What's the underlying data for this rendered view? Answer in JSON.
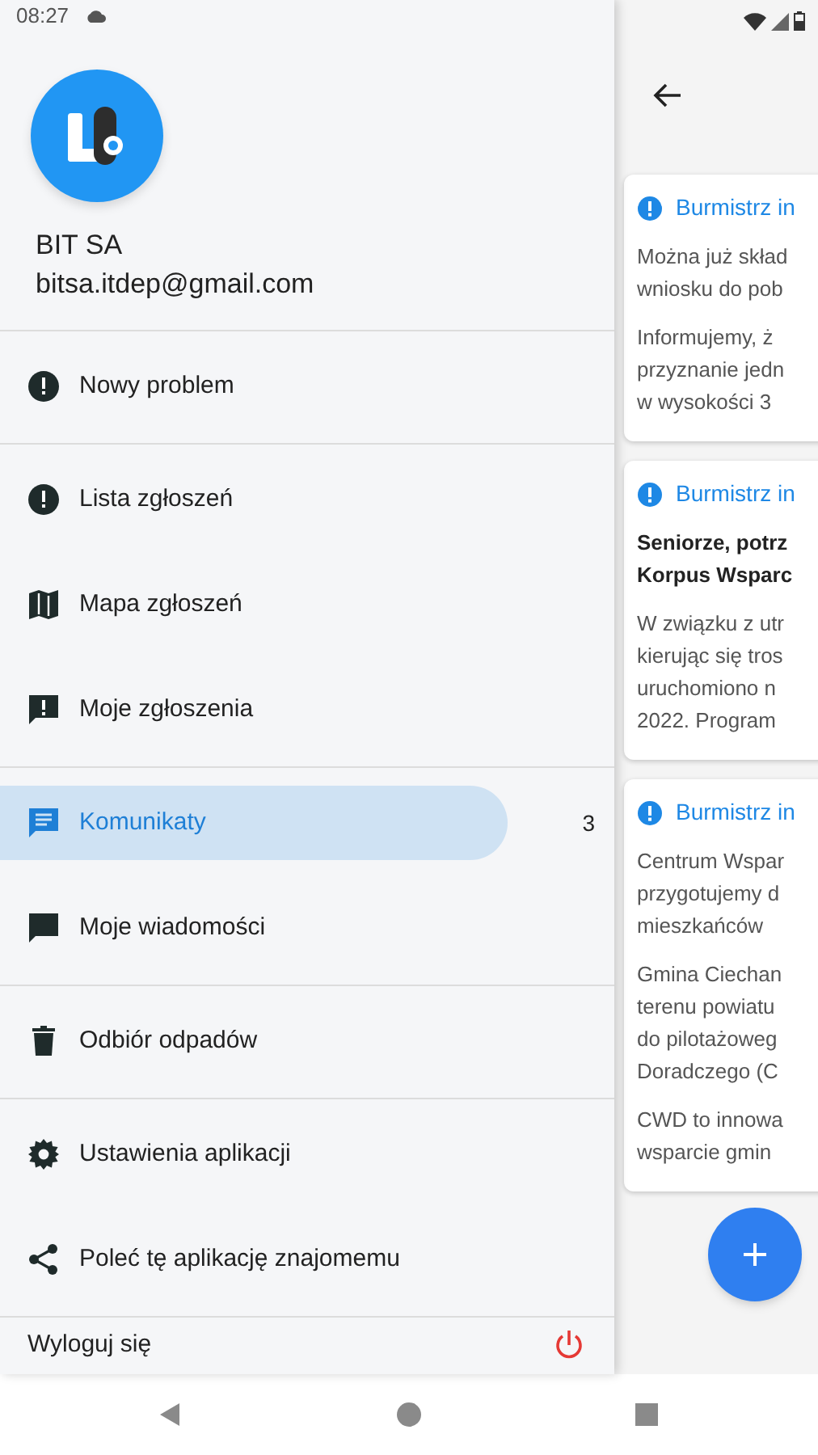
{
  "status_bar": {
    "time": "08:27"
  },
  "drawer": {
    "account": {
      "name": "BIT SA",
      "email": "bitsa.itdep@gmail.com"
    },
    "menu_groups": [
      [
        {
          "label": "Nowy problem",
          "selected": false
        }
      ],
      [
        {
          "label": "Lista zgłoszeń",
          "selected": false
        },
        {
          "label": "Mapa zgłoszeń",
          "selected": false
        },
        {
          "label": "Moje zgłoszenia",
          "selected": false
        }
      ],
      [
        {
          "label": "Komunikaty",
          "selected": true,
          "count": "3"
        },
        {
          "label": "Moje wiadomości",
          "selected": false
        }
      ],
      [
        {
          "label": "Odbiór odpadów",
          "selected": false
        }
      ],
      [
        {
          "label": "Ustawienia aplikacji",
          "selected": false
        },
        {
          "label": "Poleć tę aplikację znajomemu",
          "selected": false
        }
      ]
    ],
    "logout": {
      "label": "Wyloguj się"
    }
  },
  "messages": [
    {
      "title": "Burmistrz in",
      "paragraphs": [
        {
          "bold": false,
          "lines": [
            "Można już skład",
            "wniosku do pob"
          ]
        },
        {
          "bold": false,
          "lines": [
            "Informujemy, ż",
            "przyznanie jedn",
            "w wysokości 3"
          ]
        }
      ]
    },
    {
      "title": "Burmistrz in",
      "paragraphs": [
        {
          "bold": true,
          "lines": [
            "Seniorze, potrz",
            "Korpus Wsparc"
          ]
        },
        {
          "bold": false,
          "lines": [
            "W związku z utr",
            "kierując się tros",
            "uruchomiono n",
            "2022. Program"
          ]
        }
      ]
    },
    {
      "title": "Burmistrz in",
      "paragraphs": [
        {
          "bold": false,
          "lines": [
            "Centrum Wspar",
            "przygotujemy d",
            "mieszkańców"
          ]
        },
        {
          "bold": false,
          "lines": [
            "Gmina Ciechan",
            "terenu powiatu",
            "do pilotażoweg",
            "Doradczego (C"
          ]
        },
        {
          "bold": false,
          "lines": [
            "CWD to innowa",
            "wsparcie gmin"
          ]
        }
      ]
    }
  ]
}
